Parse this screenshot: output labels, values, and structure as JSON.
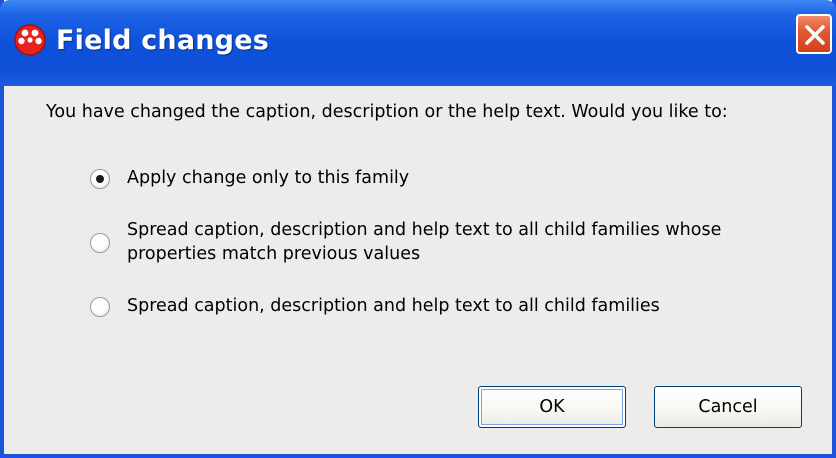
{
  "window": {
    "title": "Field changes",
    "title_bar_color": "#0d4fd6",
    "close_button_color": "#d2401b"
  },
  "dialog": {
    "prompt": "You have changed the caption, description or the help text. Would you like to:",
    "options": [
      {
        "line1": "Apply change only to this family",
        "line2": "",
        "selected": true
      },
      {
        "line1": "Spread caption, description and help text to all child families whose",
        "line2": "properties match previous values",
        "selected": false
      },
      {
        "line1": "Spread caption, description and help text to all child families",
        "line2": "",
        "selected": false
      }
    ],
    "ok_label": "OK",
    "cancel_label": "Cancel"
  },
  "icons": [
    "app-icon",
    "close-icon",
    "radio-selected-icon",
    "radio-unselected-icon"
  ]
}
